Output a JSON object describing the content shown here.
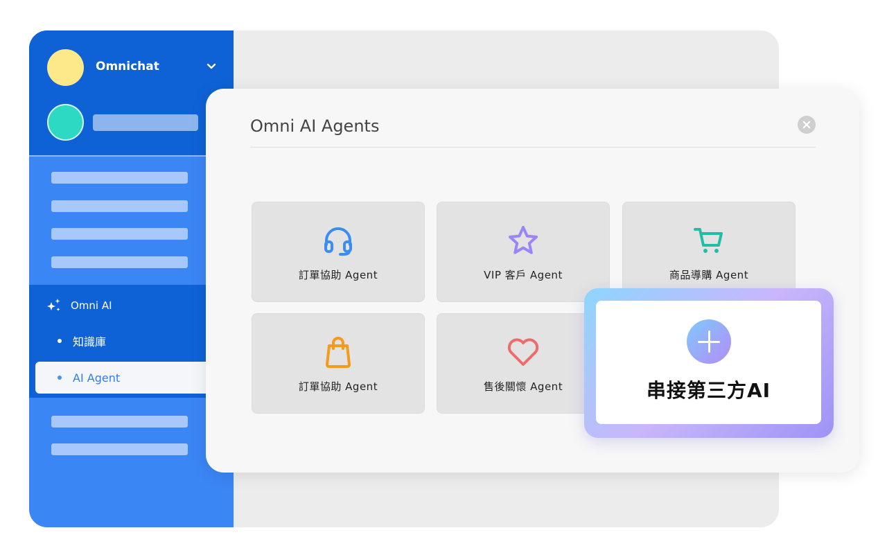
{
  "sidebar": {
    "org_name": "Omnichat",
    "ai_section": {
      "title": "Omni AI",
      "items": [
        {
          "label": "知識庫"
        },
        {
          "label": "AI Agent"
        }
      ]
    }
  },
  "modal": {
    "title": "Omni AI Agents",
    "cards": [
      {
        "label": "訂單協助 Agent",
        "icon": "headset-icon",
        "color": "#3b8cf5"
      },
      {
        "label": "VIP 客戶 Agent",
        "icon": "star-icon",
        "color": "#9b84f5"
      },
      {
        "label": "商品導購 Agent",
        "icon": "shopping-cart-icon",
        "color": "#1fbfa6"
      },
      {
        "label": "訂單協助 Agent",
        "icon": "shopping-bag-icon",
        "color": "#f59a1b"
      },
      {
        "label": "售後關懷 Agent",
        "icon": "heart-icon",
        "color": "#ef6b6b"
      }
    ],
    "integrate": {
      "label": "串接第三方AI",
      "icon": "plus-icon"
    }
  }
}
